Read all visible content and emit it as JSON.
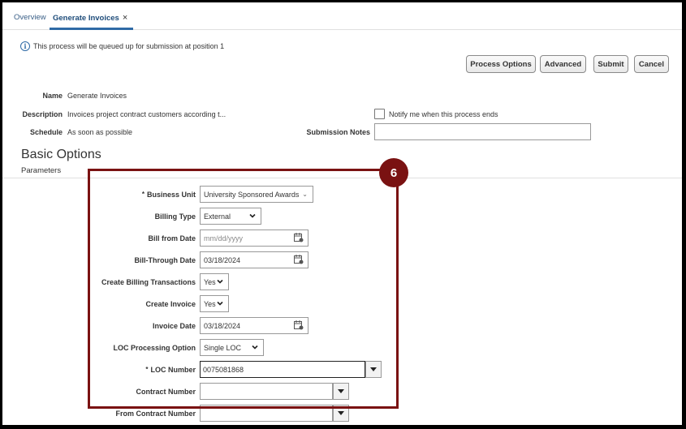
{
  "tabs": {
    "overview": "Overview",
    "generate_invoices": "Generate Invoices",
    "close": "×"
  },
  "info": {
    "icon": "info-icon",
    "message": "This process will be queued up for submission at position 1"
  },
  "actions": {
    "process_options": "Process Options",
    "advanced": "Advanced",
    "submit": "Submit",
    "cancel": "Cancel"
  },
  "header": {
    "name_label": "Name",
    "name_value": "Generate Invoices",
    "description_label": "Description",
    "description_value": "Invoices project contract customers according t...",
    "schedule_label": "Schedule",
    "schedule_value": "As soon as possible",
    "notify_label": "Notify me when this process ends",
    "notify_checked": false,
    "submission_notes_label": "Submission Notes",
    "submission_notes_value": ""
  },
  "section": {
    "title": "Basic Options",
    "subtitle": "Parameters"
  },
  "step_badge": "6",
  "highlight_color": "#7a1212",
  "form": {
    "required_marker": "*",
    "business_unit_label": "Business Unit",
    "business_unit_value": "University Sponsored Awards",
    "billing_type_label": "Billing Type",
    "billing_type_value": "External",
    "bill_from_date_label": "Bill from Date",
    "bill_from_date_placeholder": "mm/dd/yyyy",
    "bill_through_date_label": "Bill-Through Date",
    "bill_through_date_value": "03/18/2024",
    "create_billing_transactions_label": "Create Billing Transactions",
    "create_billing_transactions_value": "Yes",
    "create_invoice_label": "Create Invoice",
    "create_invoice_value": "Yes",
    "invoice_date_label": "Invoice Date",
    "invoice_date_value": "03/18/2024",
    "loc_processing_option_label": "LOC Processing Option",
    "loc_processing_option_value": "Single LOC",
    "loc_number_label": "LOC Number",
    "loc_number_value": "0075081868",
    "contract_number_label": "Contract Number",
    "contract_number_value": "",
    "from_contract_number_label": "From Contract Number",
    "from_contract_number_value": ""
  }
}
